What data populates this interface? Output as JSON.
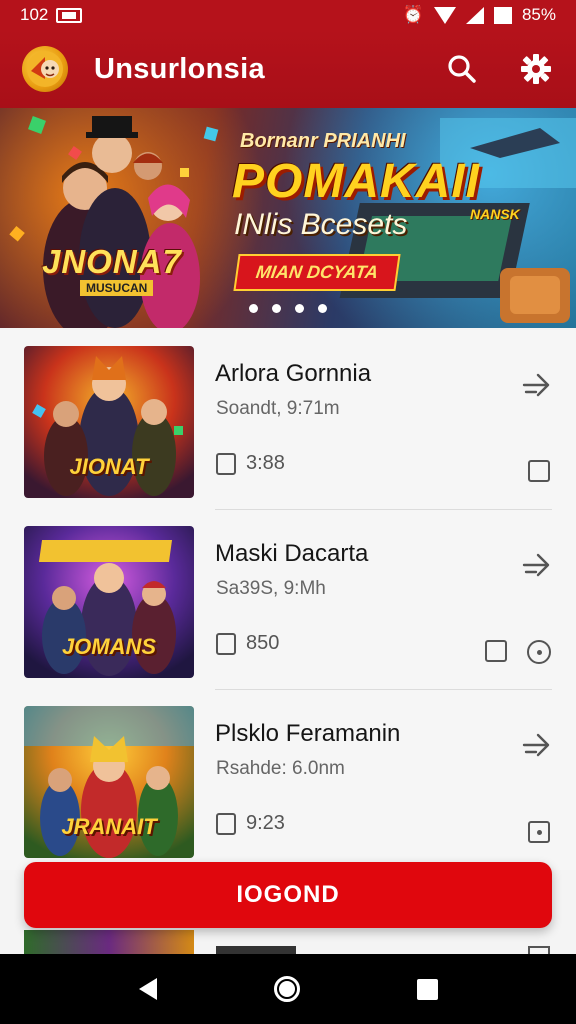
{
  "status_bar": {
    "time": "102",
    "battery": "85%"
  },
  "app_bar": {
    "title": "Unsurlonsia"
  },
  "banner": {
    "game_title": "JNONA7",
    "game_subtitle": "MUSUCAN",
    "kicker": "Bornanr PRIANHI",
    "headline": "POMAKAII",
    "subtitle": "INlis Bcesets",
    "cta": "MIAN DCYATA",
    "tag": "NANSK",
    "page_count": 4
  },
  "games": [
    {
      "title": "Arlora Gornnia",
      "subtitle": "Soandt, 9:71m",
      "meta": "3:88",
      "thumb_label": "JIONAT",
      "thumb_colors": [
        "#f1a22a",
        "#c9331b",
        "#3a1830"
      ]
    },
    {
      "title": "Maski Dacarta",
      "subtitle": "Sa39S, 9:Mh",
      "meta": "850",
      "thumb_label": "JOMANS",
      "thumb_colors": [
        "#c54cd0",
        "#5a2a9a",
        "#1f1640"
      ]
    },
    {
      "title": "Plsklo Feramanin",
      "subtitle": "Rsahde: 6.0nm",
      "meta": "9:23",
      "thumb_label": "JRANAIT",
      "thumb_colors": [
        "#3aa0e0",
        "#e0821b",
        "#2e5a20"
      ]
    }
  ],
  "primary_button": {
    "label": "IOGOND"
  },
  "colors": {
    "brand": "#b5121b",
    "accent": "#e0070d"
  }
}
